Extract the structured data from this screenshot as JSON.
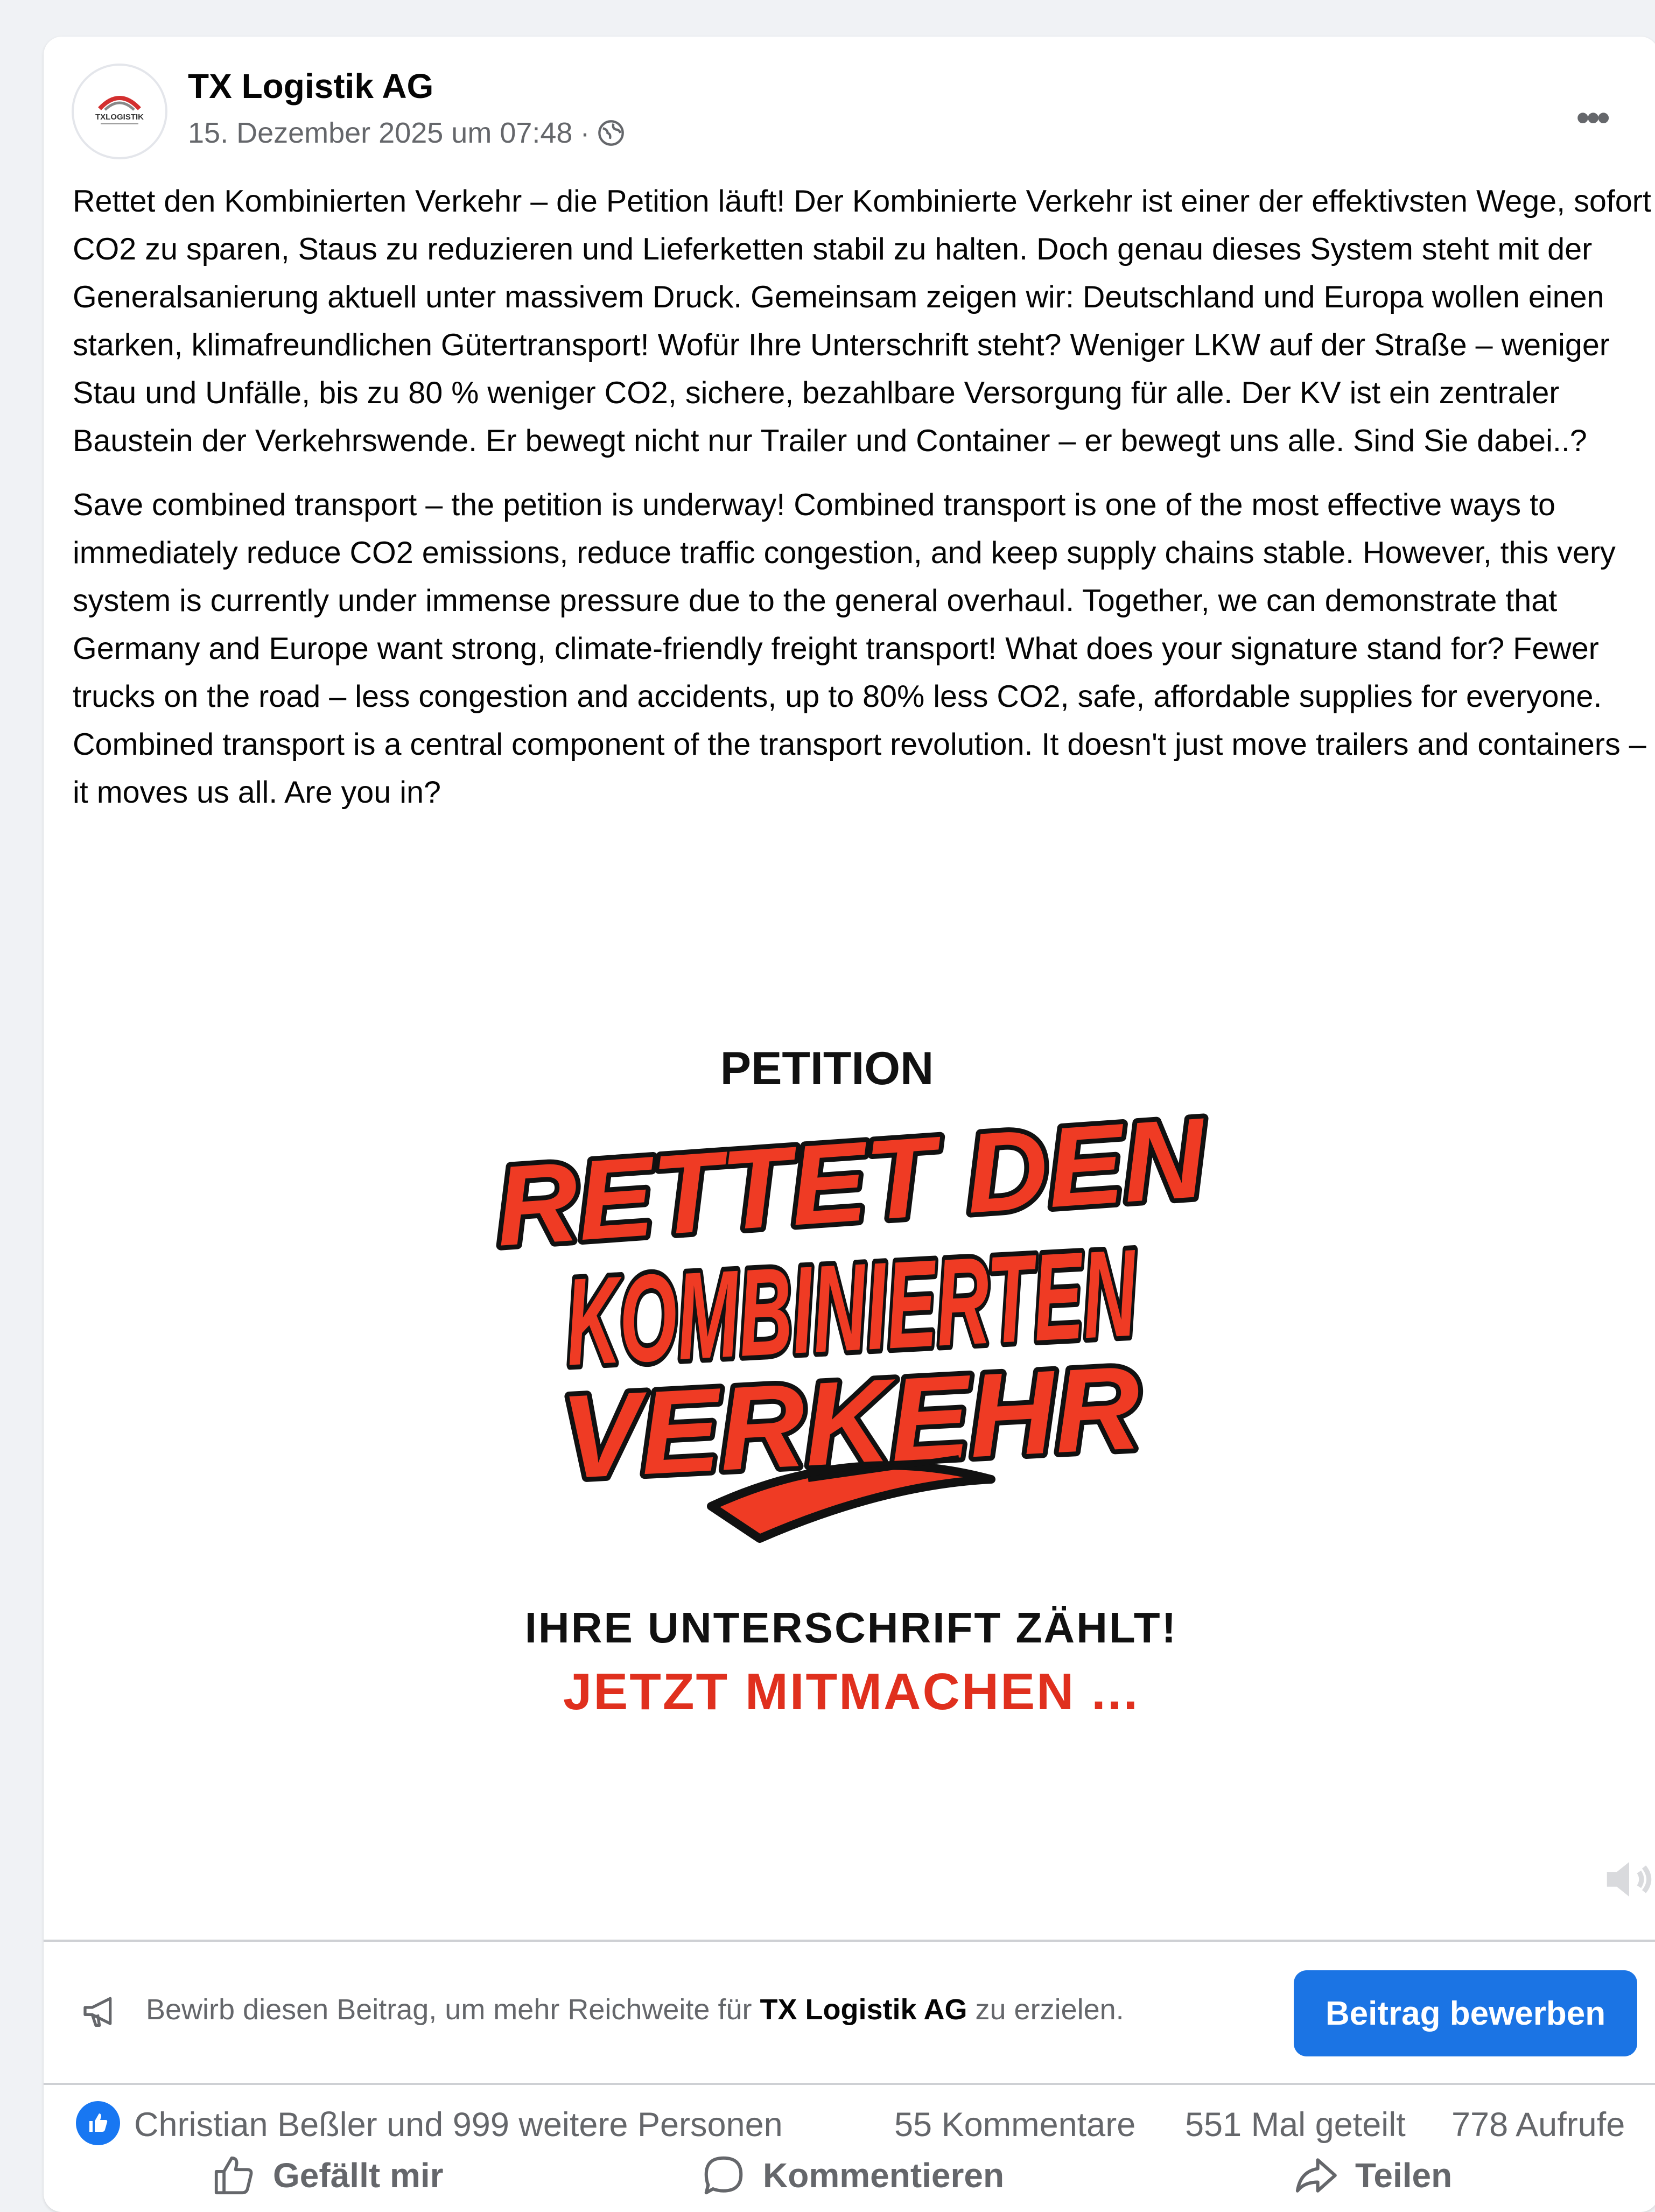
{
  "post": {
    "author": "TX Logistik AG",
    "timestamp": "15. Dezember 2025 um 07:48",
    "separator": "·",
    "avatar_logo_text": "TXLOGISTIK",
    "paragraphs": [
      "Rettet den Kombinierten Verkehr – die Petition läuft! Der Kombinierte Verkehr ist einer der effektivsten Wege, sofort CO2 zu sparen, Staus zu reduzieren und Lieferketten stabil zu halten. Doch genau dieses System steht mit der Generalsanierung aktuell unter massivem Druck. Gemeinsam zeigen wir: Deutschland und Europa wollen einen starken, klimafreundlichen Gütertransport! Wofür Ihre Unterschrift steht? Weniger LKW auf der Straße – weniger Stau und Unfälle, bis zu 80 % weniger CO2, sichere, bezahlbare Versorgung für alle. Der KV ist ein zentraler Baustein der Verkehrswende. Er bewegt nicht nur Trailer und Container – er bewegt uns alle. Sind Sie dabei..?",
      "Save combined transport – the petition is underway! Combined transport is one of the most effective ways to immediately reduce CO2 emissions, reduce traffic congestion, and keep supply chains stable. However, this very system is currently under immense pressure due to the general overhaul. Together, we can demonstrate that Germany and Europe want strong, climate-friendly freight transport! What does your signature stand for? Fewer trucks on the road – less congestion and accidents, up to 80% less CO2, safe, affordable supplies for everyone. Combined transport is a central component of the transport revolution. It doesn't just move trailers and containers – it moves us all. Are you in?"
    ]
  },
  "media": {
    "heading": "PETITION",
    "graffiti_lines": [
      "RETTET DEN",
      "KOMBINIERTEN",
      "VERKEHR"
    ],
    "subline": "IHRE UNTERSCHRIFT ZÄHLT!",
    "cta": "JETZT MITMACHEN ...",
    "colors": {
      "graffiti_fill": "#ef3b24",
      "outline": "#111111",
      "cta": "#e0301e"
    }
  },
  "promo": {
    "text_before": "Bewirb diesen Beitrag, um mehr Reichweite für ",
    "text_bold": "TX Logistik AG",
    "text_after": " zu erzielen.",
    "button": "Beitrag bewerben"
  },
  "stats": {
    "likers": "Christian Beßler und 999 weitere Personen",
    "comments": "55 Kommentare",
    "shares": "551 Mal geteilt",
    "views": "778 Aufrufe"
  },
  "actions": {
    "like": "Gefällt mir",
    "comment": "Kommentieren",
    "share": "Teilen"
  },
  "colors": {
    "accent": "#1b74e4",
    "like_blue": "#1877f2",
    "secondary_text": "#65676b",
    "background": "#f0f2f5"
  }
}
